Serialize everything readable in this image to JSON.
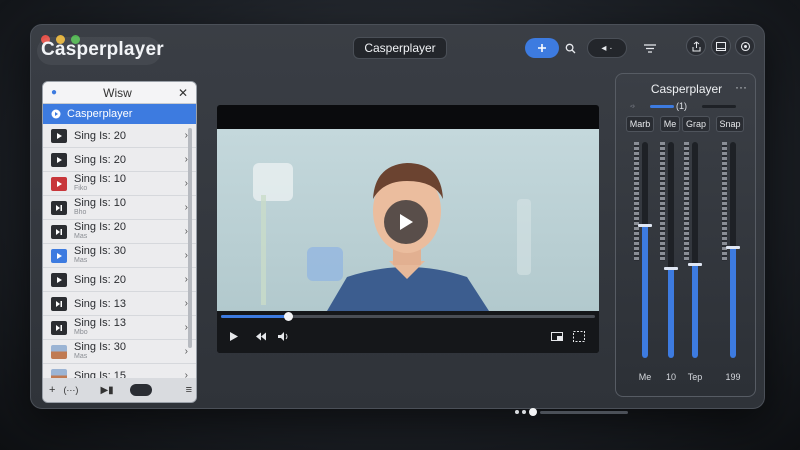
{
  "window": {
    "app_name": "Casperplayer",
    "title": "Casperplayer"
  },
  "colors": {
    "accent": "#3d7be0",
    "close": "#e5534b",
    "minimize": "#e3b23c",
    "zoom": "#52b552"
  },
  "toolbar": {
    "add_icon": "plus-icon",
    "search_icon": "search-icon",
    "playback_pill": "◂ ·",
    "menu_icon": "menu-icon",
    "share_icon": "share-icon",
    "sidebar_icon": "sidebar-icon",
    "settings_icon": "gear-icon"
  },
  "playlist": {
    "header": "Wisw",
    "active_item": "Casperplayer",
    "items": [
      {
        "label": "Sing Is: 20",
        "sub": "",
        "icon": "play-icon",
        "thumb": "dark"
      },
      {
        "label": "Sing Is: 20",
        "sub": "",
        "icon": "play-icon",
        "thumb": "dark"
      },
      {
        "label": "Sing Is: 10",
        "sub": "Fiko",
        "icon": "play-icon",
        "thumb": "red"
      },
      {
        "label": "Sing Is: 10",
        "sub": "Bho",
        "icon": "skip-icon",
        "thumb": "dark"
      },
      {
        "label": "Sing Is: 20",
        "sub": "Mas",
        "icon": "skip-icon",
        "thumb": "dark"
      },
      {
        "label": "Sing Is: 30",
        "sub": "Mas",
        "icon": "play-icon",
        "thumb": "blue"
      },
      {
        "label": "Sing Is: 20",
        "sub": "",
        "icon": "play-icon",
        "thumb": "dark"
      },
      {
        "label": "Sing Is: 13",
        "sub": "",
        "icon": "skip-icon",
        "thumb": "dark"
      },
      {
        "label": "Sing Is: 13",
        "sub": "Mbo",
        "icon": "skip-icon",
        "thumb": "dark"
      },
      {
        "label": "Sing Is: 30",
        "sub": "Mas",
        "icon": "image-icon",
        "thumb": "photo"
      },
      {
        "label": "Sing Is: 15",
        "sub": "",
        "icon": "image-icon",
        "thumb": "photo"
      }
    ]
  },
  "player": {
    "progress": 0.18,
    "state": "paused"
  },
  "mixer": {
    "title": "Casperplayer",
    "tabs": [
      "Marb",
      "Me",
      "Grap",
      "Snap"
    ],
    "top_slider_value": "(1)",
    "channels": [
      {
        "label": "Me",
        "level": 0.62
      },
      {
        "label": "10",
        "level": 0.42
      },
      {
        "label": "Tep",
        "level": 0.44
      },
      {
        "label": "199",
        "level": 0.52
      }
    ]
  }
}
